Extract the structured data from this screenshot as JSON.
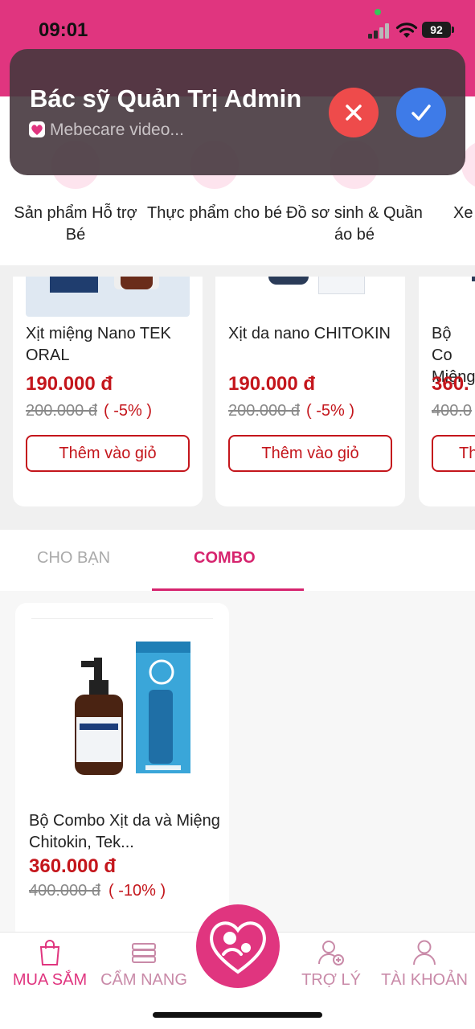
{
  "status_bar": {
    "time": "09:01",
    "battery": "92"
  },
  "notification": {
    "title": "Bác sỹ Quản Trị Admin",
    "subtitle": "Mebecare video...",
    "decline_icon": "close-icon",
    "accept_icon": "check-icon"
  },
  "categories": [
    {
      "label": "Sản phẩm Hỗ trợ Bé"
    },
    {
      "label": "Thực phẩm cho bé"
    },
    {
      "label": "Đồ sơ sinh & Quần áo bé"
    },
    {
      "label": "Xe"
    }
  ],
  "products": [
    {
      "name": "Xịt miệng Nano TEK ORAL",
      "price": "190.000 đ",
      "old_price": "200.000 đ",
      "discount": "( -5% )",
      "button": "Thêm vào giỏ"
    },
    {
      "name": "Xịt da nano CHITOKIN",
      "price": "190.000 đ",
      "old_price": "200.000 đ",
      "discount": "( -5% )",
      "button": "Thêm vào giỏ"
    },
    {
      "name": "Bộ Co Miệng",
      "price": "360.",
      "old_price": "400.0",
      "discount": "",
      "button": "Th"
    }
  ],
  "tabs": [
    {
      "label": "CHO BẠN",
      "active": false
    },
    {
      "label": "COMBO",
      "active": true
    }
  ],
  "combo": {
    "name": "Bộ Combo Xịt da và Miệng Chitokin, Tek...",
    "price": "360.000 đ",
    "old_price": "400.000 đ",
    "discount": "( -10% )"
  },
  "bottom_nav": [
    {
      "label": "MUA SẮM",
      "icon": "shopping-bag-icon",
      "active": true
    },
    {
      "label": "CẨM NANG",
      "icon": "book-icon",
      "active": false
    },
    {
      "label": "TRỢ LÝ",
      "icon": "add-user-icon",
      "active": false
    },
    {
      "label": "TÀI KHOẢN",
      "icon": "user-icon",
      "active": false
    }
  ],
  "fab_icon": "mother-baby-heart-icon",
  "colors": {
    "brand": "#e0357f",
    "price": "#c4161c",
    "tab_active": "#d6246e"
  }
}
